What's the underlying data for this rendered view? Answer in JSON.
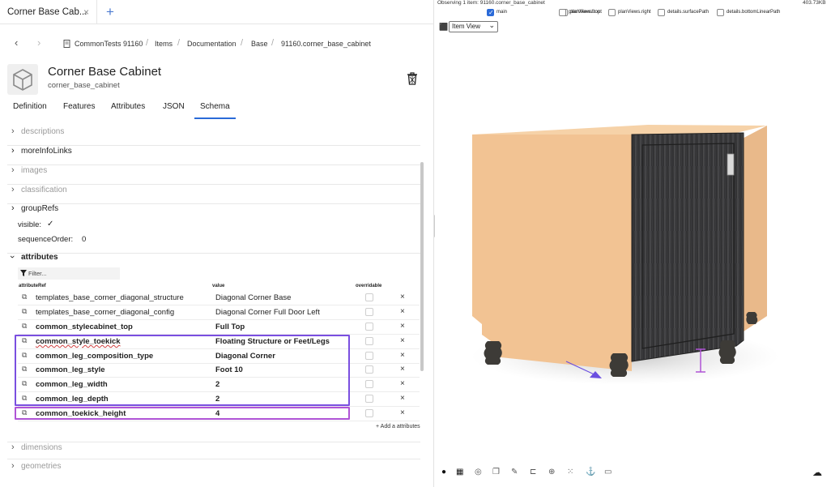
{
  "tab": {
    "title": "Corner Base Cab...",
    "close": "×",
    "add": "+"
  },
  "breadcrumb": {
    "back": "‹",
    "forward": "›",
    "items": [
      "CommonTests 91160",
      "Items",
      "Documentation",
      "Base",
      "91160.corner_base_cabinet"
    ],
    "sep": "/"
  },
  "item": {
    "title": "Corner Base Cabinet",
    "subtitle": "corner_base_cabinet"
  },
  "schema_tabs": [
    "Definition",
    "Features",
    "Attributes",
    "JSON",
    "Schema"
  ],
  "schema_active": "Schema",
  "sections": {
    "descriptions": "descriptions",
    "moreInfoLinks": "moreInfoLinks",
    "images": "images",
    "classification": "classification",
    "groupRefs": "groupRefs",
    "visible_label": "visible:",
    "sequence_label": "sequenceOrder:",
    "sequence_value": "0",
    "attributes": "attributes",
    "dimensions": "dimensions",
    "geometries": "geometries"
  },
  "filter": {
    "placeholder": "Filter..."
  },
  "columns": {
    "ref": "attributeRef",
    "value": "value",
    "overridable": "overridable"
  },
  "attributes": [
    {
      "name": "templates_base_corner_diagonal_structure",
      "value": "Diagonal Corner Base",
      "bold": false
    },
    {
      "name": "templates_base_corner_diagonal_config",
      "value": "Diagonal Corner Full Door Left",
      "bold": false
    },
    {
      "name": "common_stylecabinet_top",
      "value": "Full Top",
      "bold": true
    },
    {
      "name": "common_style_toekick",
      "value": "Floating Structure or Feet/Legs",
      "bold": true
    },
    {
      "name": "common_leg_composition_type",
      "value": "Diagonal Corner",
      "bold": true
    },
    {
      "name": "common_leg_style",
      "value": "Foot 10",
      "bold": true
    },
    {
      "name": "common_leg_width",
      "value": "2",
      "bold": true
    },
    {
      "name": "common_leg_depth",
      "value": "2",
      "bold": true
    },
    {
      "name": "common_toekick_height",
      "value": "4",
      "bold": true
    }
  ],
  "remove_symbol": "×",
  "add_attribute": "+ Add a attributes",
  "viewer": {
    "observing": "Observing 1 item: 91160.corner_base_cabinet",
    "size": "403.73KB",
    "checkboxes": [
      {
        "label": "main",
        "checked": true
      },
      {
        "label": "planViews.top",
        "checked": false
      },
      {
        "label": "planViews.front",
        "checked": false
      },
      {
        "label": "planViews.right",
        "checked": false
      },
      {
        "label": "details.surfacePath",
        "checked": false
      },
      {
        "label": "details.bottomLinearPath",
        "checked": false
      }
    ],
    "view_select": "Item View",
    "colors": {
      "carcass": "#f2c393",
      "door": "#3a3a3c",
      "annotation": "#6b4fe0"
    }
  }
}
